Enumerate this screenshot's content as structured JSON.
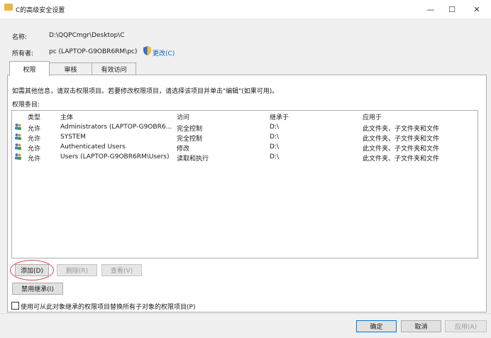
{
  "window": {
    "title": "C的高级安全设置",
    "minimize": "—",
    "maximize": "☐",
    "close": "✕"
  },
  "info": {
    "name_label": "名称:",
    "name_value": "D:\\QQPCmgr\\Desktop\\C",
    "owner_label": "所有者:",
    "owner_value": "pc (LAPTOP-G9OBR6RM\\pc)",
    "change_link": "更改(C)"
  },
  "tabs": [
    {
      "label": "权限",
      "active": true
    },
    {
      "label": "审核",
      "active": false
    },
    {
      "label": "有效访问",
      "active": false
    }
  ],
  "instructions": "如需其他信息，请双击权限项目。若要修改权限项目，请选择该项目并单击\"编辑\"(如果可用)。",
  "entries_label": "权限条目:",
  "columns": [
    "类型",
    "主体",
    "访问",
    "继承于",
    "应用于"
  ],
  "rows": [
    {
      "type": "允许",
      "principal": "Administrators (LAPTOP-G9OBR6...",
      "access": "完全控制",
      "inherited": "D:\\",
      "applies": "此文件夹、子文件夹和文件"
    },
    {
      "type": "允许",
      "principal": "SYSTEM",
      "access": "完全控制",
      "inherited": "D:\\",
      "applies": "此文件夹、子文件夹和文件"
    },
    {
      "type": "允许",
      "principal": "Authenticated Users",
      "access": "修改",
      "inherited": "D:\\",
      "applies": "此文件夹、子文件夹和文件"
    },
    {
      "type": "允许",
      "principal": "Users (LAPTOP-G9OBR6RM\\Users)",
      "access": "读取和执行",
      "inherited": "D:\\",
      "applies": "此文件夹、子文件夹和文件"
    }
  ],
  "buttons": {
    "add": "添加(D)",
    "remove": "删除(R)",
    "view": "查看(V)",
    "disable_inheritance": "禁用继承(I)",
    "ok": "确定",
    "cancel": "取消",
    "apply": "应用(A)"
  },
  "checkbox": {
    "label": "使用可从此对象继承的权限项目替换所有子对象的权限项目(P)",
    "checked": false
  },
  "colors": {
    "accent": "#0078d7",
    "highlight_ring": "#dd4444",
    "folder": "#e8b64a"
  }
}
